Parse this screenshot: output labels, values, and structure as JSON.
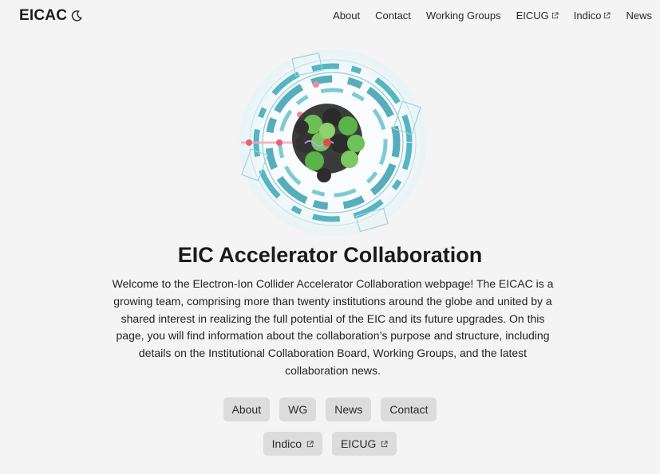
{
  "header": {
    "brand": "EICAC",
    "theme_icon": "moon-icon",
    "nav": [
      {
        "label": "About",
        "external": false
      },
      {
        "label": "Contact",
        "external": false
      },
      {
        "label": "Working Groups",
        "external": false
      },
      {
        "label": "EICUG",
        "external": true
      },
      {
        "label": "Indico",
        "external": true
      },
      {
        "label": "News",
        "external": false
      }
    ]
  },
  "hero": {
    "title": "EIC Accelerator Collaboration",
    "intro": "Welcome to the Electron-Ion Collider Accelerator Collaboration webpage! The EICAC is a growing team, comprising more than twenty institutions around the globe and united by a shared interest in realizing the full potential of the EIC and its future upgrades. On this page, you will find information about the collaboration’s purpose and structure, including details on the Institutional Collaboration Board, Working Groups, and the latest collaboration news."
  },
  "buttons": {
    "row1": [
      "About",
      "WG",
      "News",
      "Contact"
    ],
    "row2": [
      "Indico",
      "EICUG"
    ]
  },
  "colors": {
    "accent_teal": "#3aa9b8",
    "green": "#5bb34a",
    "dark_sphere": "#2b2b2b",
    "button_bg": "#dcdcdc",
    "background": "#f4f4f4"
  }
}
